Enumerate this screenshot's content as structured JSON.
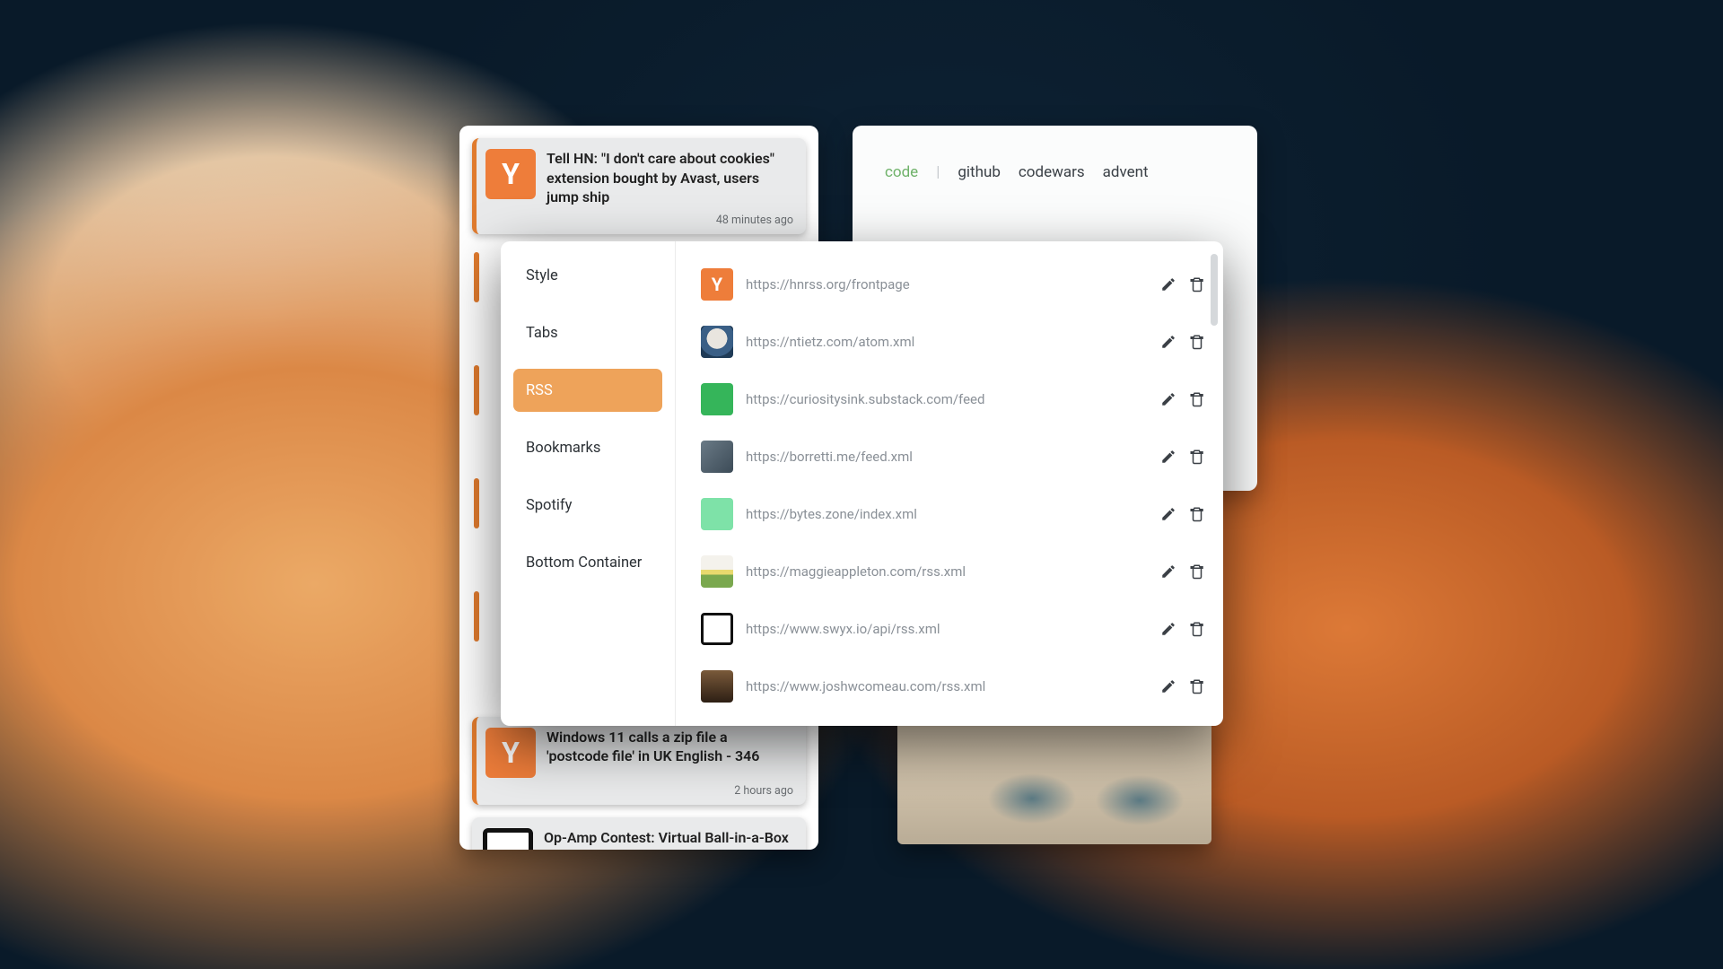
{
  "colors": {
    "accent_orange": "#ee7d3a",
    "settings_active": "#eea35a",
    "tab_active": "#6fb26a"
  },
  "left_feed": {
    "items": [
      {
        "icon": "hn",
        "title": "Tell HN: \"I don't care about cookies\" extension bought by Avast, users jump ship",
        "ago": "48 minutes ago"
      },
      {
        "icon": "hn",
        "title": "Windows 11 calls a zip file a 'postcode file' in UK English - 346",
        "ago": "2 hours ago"
      },
      {
        "icon": "black",
        "title": "Op-Amp Contest: Virtual Ball-in-a-Box Responds to Your Motions",
        "ago": ""
      }
    ]
  },
  "tabs_panel": {
    "active": "code",
    "links": [
      "github",
      "codewars",
      "advent"
    ]
  },
  "settings": {
    "nav": [
      {
        "key": "style",
        "label": "Style"
      },
      {
        "key": "tabs",
        "label": "Tabs"
      },
      {
        "key": "rss",
        "label": "RSS",
        "active": true
      },
      {
        "key": "bookmarks",
        "label": "Bookmarks"
      },
      {
        "key": "spotify",
        "label": "Spotify"
      },
      {
        "key": "bottom",
        "label": "Bottom Container"
      }
    ],
    "feeds": [
      {
        "icon": "hn",
        "url": "https://hnrss.org/frontpage"
      },
      {
        "icon": "coffee",
        "url": "https://ntietz.com/atom.xml"
      },
      {
        "icon": "greencircle",
        "url": "https://curiositysink.substack.com/feed"
      },
      {
        "icon": "photo",
        "url": "https://borretti.me/feed.xml"
      },
      {
        "icon": "mint",
        "url": "https://bytes.zone/index.xml"
      },
      {
        "icon": "flowers",
        "url": "https://maggieappleton.com/rss.xml"
      },
      {
        "icon": "swyx",
        "url": "https://www.swyx.io/api/rss.xml"
      },
      {
        "icon": "josh",
        "url": "https://www.joshwcomeau.com/rss.xml"
      }
    ]
  }
}
